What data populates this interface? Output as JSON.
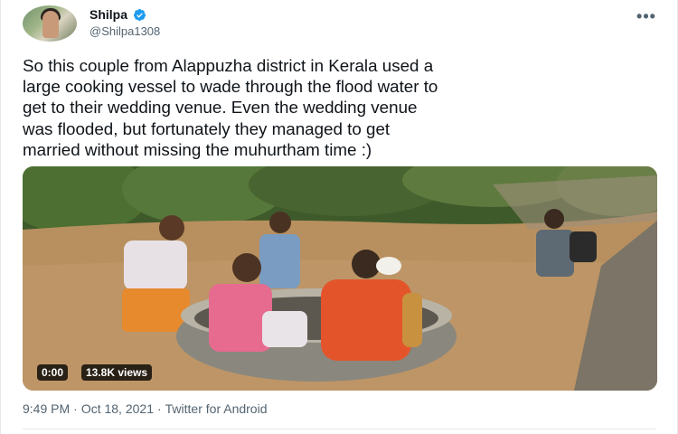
{
  "author": {
    "display_name": "Shilpa",
    "handle": "@Shilpa1308",
    "verified": true
  },
  "menu_icon": "more-horizontal-icon",
  "tweet": {
    "text": "So this couple from Alappuzha district in Kerala used a\nlarge cooking vessel to wade through the flood water to\nget to their wedding venue. Even the wedding venue\nwas flooded, but fortunately they managed to get\nmarried without missing the muhurtham time :)"
  },
  "video": {
    "time": "0:00",
    "views": "13.8K views"
  },
  "meta": {
    "time": "9:49 PM",
    "separator": "·",
    "date": "Oct 18, 2021",
    "source": "Twitter for Android"
  },
  "colors": {
    "verified_blue": "#1d9bf0",
    "secondary_text": "#536471",
    "primary_text": "#0f1419"
  }
}
